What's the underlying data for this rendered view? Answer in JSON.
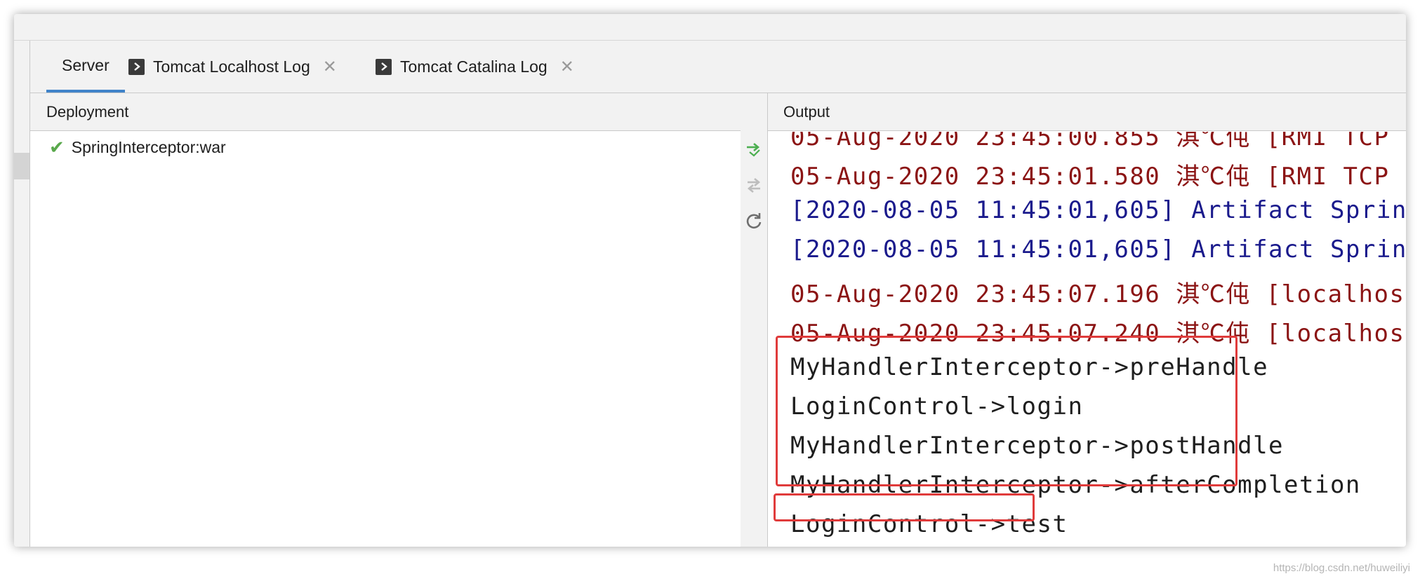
{
  "tabs": [
    {
      "label": "Server",
      "active": true,
      "icon": "none",
      "closable": false
    },
    {
      "label": "Tomcat Localhost Log",
      "active": false,
      "icon": "console-icon",
      "closable": true
    },
    {
      "label": "Tomcat Catalina Log",
      "active": false,
      "icon": "console-icon",
      "closable": true
    }
  ],
  "deployment": {
    "header": "Deployment",
    "items": [
      {
        "label": "SpringInterceptor:war",
        "status": "deployed",
        "status_icon": "check-icon"
      }
    ]
  },
  "toolbar": {
    "icons": [
      "deploy-icon",
      "undeploy-icon",
      "refresh-icon"
    ]
  },
  "output": {
    "header": "Output",
    "lines": [
      {
        "text": "05-Aug-2020 23:45:00.855 淇℃伅 [RMI TCP",
        "color": "#8b1414"
      },
      {
        "text": "05-Aug-2020 23:45:01.580 淇℃伅 [RMI TCP",
        "color": "#8b1414"
      },
      {
        "text": "[2020-08-05 11:45:01,605] Artifact Sprin",
        "color": "#1a1a8c"
      },
      {
        "text": "[2020-08-05 11:45:01,605] Artifact Sprin",
        "color": "#1a1a8c"
      },
      {
        "text": "05-Aug-2020 23:45:07.196 淇℃伅 [localhos",
        "color": "#8b1414"
      },
      {
        "text": "05-Aug-2020 23:45:07.240 淇℃伅 [localhos",
        "color": "#8b1414"
      },
      {
        "text": "MyHandlerInterceptor->preHandle",
        "color": "#1e1e1e"
      },
      {
        "text": "LoginControl->login",
        "color": "#1e1e1e"
      },
      {
        "text": "MyHandlerInterceptor->postHandle",
        "color": "#1e1e1e"
      },
      {
        "text": "MyHandlerInterceptor->afterCompletion",
        "color": "#1e1e1e"
      },
      {
        "text": "LoginControl->test",
        "color": "#1e1e1e"
      }
    ]
  },
  "colors": {
    "accent": "#4083c9",
    "highlight_border": "#e03b3b",
    "check": "#59a84b"
  },
  "watermark": "https://blog.csdn.net/huweiliyi"
}
